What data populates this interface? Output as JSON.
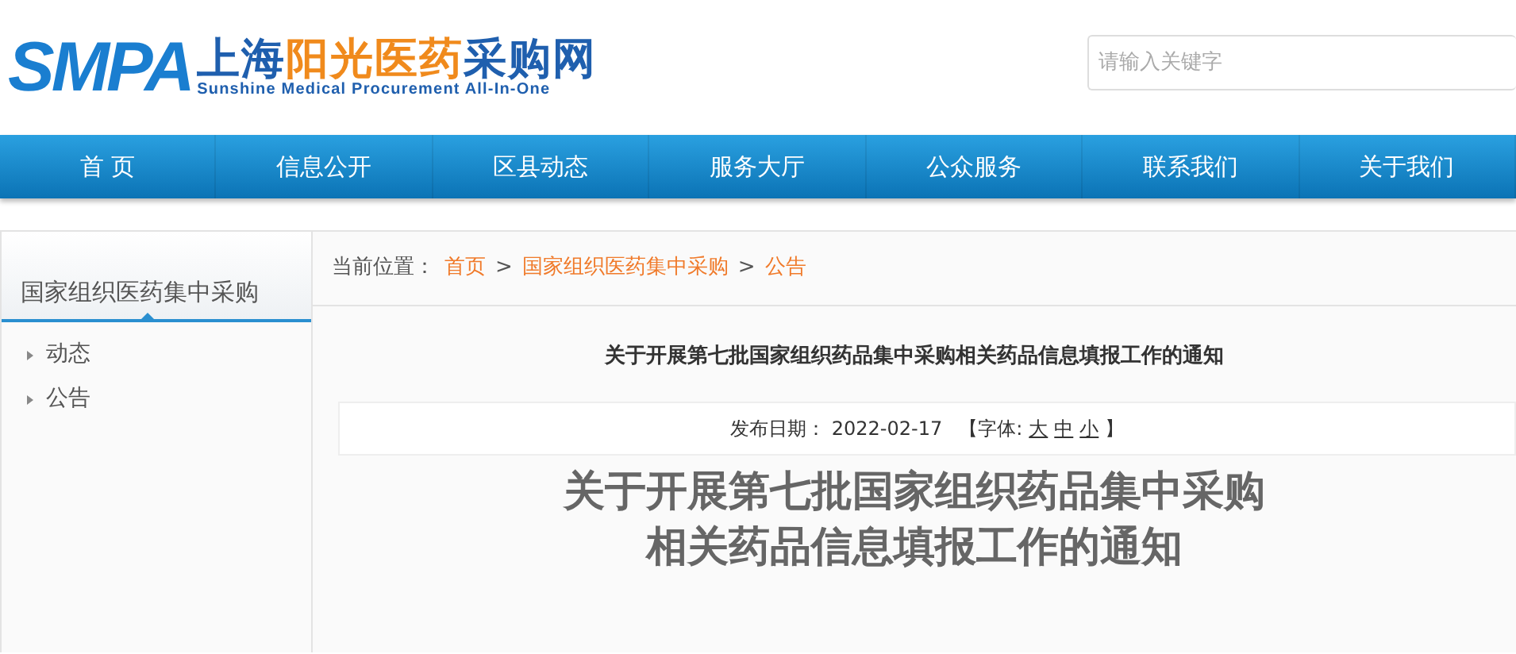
{
  "logo": {
    "mark": "SMPA",
    "title_parts": [
      {
        "text": "上海",
        "color": "#1f5fae"
      },
      {
        "text": "阳光医药",
        "color": "#f08a1c"
      },
      {
        "text": "采购网",
        "color": "#1f5fae"
      }
    ],
    "subtitle": "Sunshine Medical Procurement All-In-One"
  },
  "search": {
    "placeholder": "请输入关键字"
  },
  "nav": [
    {
      "label": "首 页"
    },
    {
      "label": "信息公开"
    },
    {
      "label": "区县动态"
    },
    {
      "label": "服务大厅"
    },
    {
      "label": "公众服务"
    },
    {
      "label": "联系我们"
    },
    {
      "label": "关于我们"
    }
  ],
  "sidebar": {
    "title": "国家组织医药集中采购",
    "items": [
      {
        "label": "动态"
      },
      {
        "label": "公告"
      }
    ]
  },
  "breadcrumb": {
    "label": "当前位置：",
    "separator": ">",
    "items": [
      {
        "text": "首页"
      },
      {
        "text": "国家组织医药集中采购"
      },
      {
        "text": "公告"
      }
    ]
  },
  "article": {
    "title": "关于开展第七批国家组织药品集中采购相关药品信息填报工作的通知",
    "date_label": "发布日期：",
    "date": "2022-02-17",
    "font_label": "【字体:",
    "font_sizes": [
      "大",
      "中",
      "小"
    ],
    "font_close": "】",
    "heading_lines": [
      "关于开展第七批国家组织药品集中采购",
      "相关药品信息填报工作的通知"
    ]
  }
}
